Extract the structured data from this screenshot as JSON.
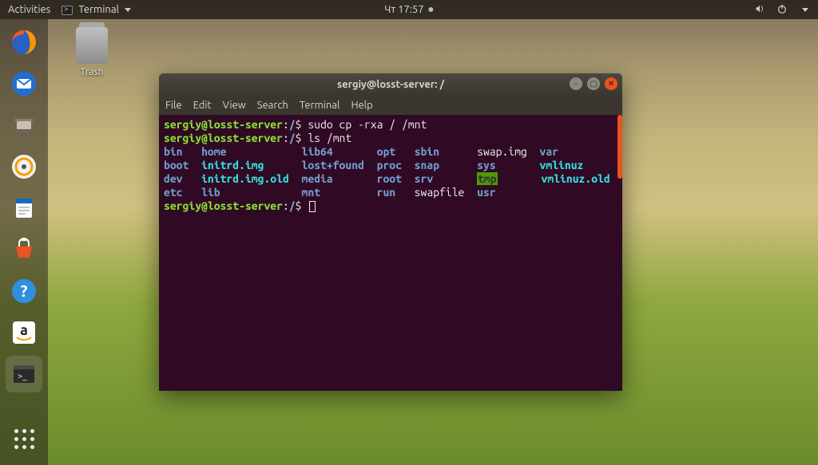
{
  "topbar": {
    "activities": "Activities",
    "app_indicator": "Terminal",
    "clock": "Чт 17:57"
  },
  "desktop": {
    "trash_label": "Trash"
  },
  "dock": {
    "items": [
      "firefox",
      "thunderbird",
      "files",
      "rhythmbox",
      "writer",
      "software",
      "help",
      "amazon",
      "terminal"
    ]
  },
  "window": {
    "title": "sergiy@losst-server: /",
    "menu": {
      "file": "File",
      "edit": "Edit",
      "view": "View",
      "search": "Search",
      "terminal": "Terminal",
      "help": "Help"
    }
  },
  "terminal": {
    "prompt": {
      "userhost": "sergiy@losst-server",
      "path": "/",
      "sep": ":",
      "sigil": "$"
    },
    "lines": {
      "cmd1": "sudo cp -rxa /  /mnt",
      "cmd2": "ls /mnt"
    },
    "ls": {
      "r1c1": "bin",
      "r1c2": "home",
      "r1c3": "lib64",
      "r1c4": "opt",
      "r1c5": "sbin",
      "r1c6": "swap.img",
      "r1c7": "var",
      "r2c1": "boot",
      "r2c2": "initrd.img",
      "r2c3": "lost+found",
      "r2c4": "proc",
      "r2c5": "snap",
      "r2c6": "sys",
      "r2c7": "vmlinuz",
      "r3c1": "dev",
      "r3c2": "initrd.img.old",
      "r3c3": "media",
      "r3c4": "root",
      "r3c5": "srv",
      "r3c6": "tmp",
      "r3c7": "vmlinuz.old",
      "r4c1": "etc",
      "r4c2": "lib",
      "r4c3": "mnt",
      "r4c4": "run",
      "r4c5": "swapfile",
      "r4c6": "usr"
    }
  }
}
